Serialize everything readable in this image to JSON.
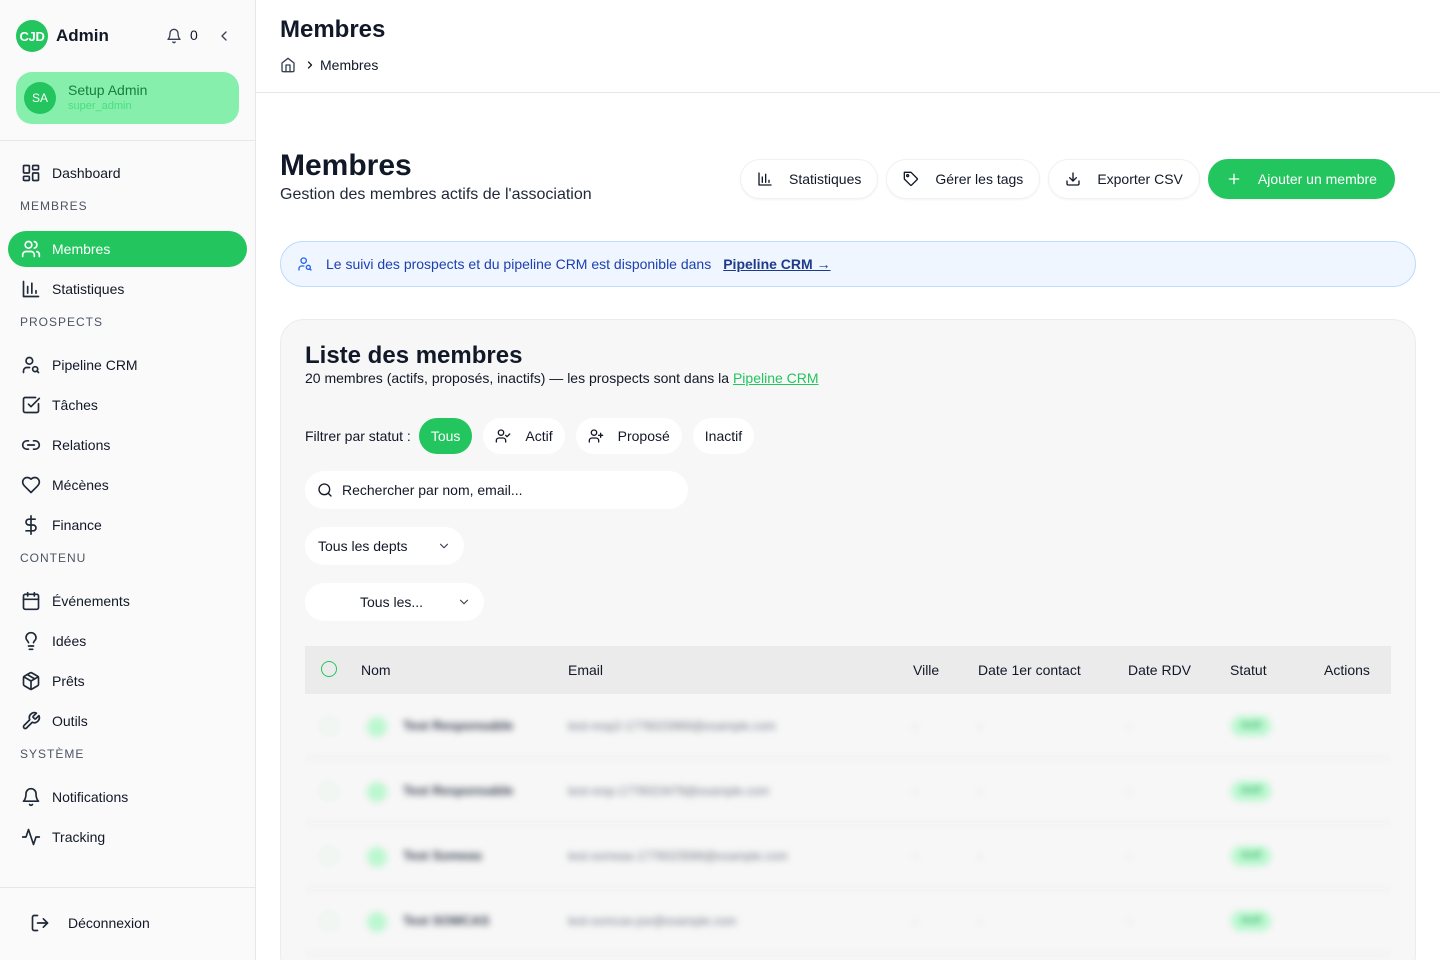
{
  "sidebar": {
    "logo_text": "CJD",
    "app_title": "Admin",
    "notif_count": "0",
    "user": {
      "initials": "SA",
      "name": "Setup Admin",
      "role": "super_admin"
    },
    "nav": [
      {
        "type": "item",
        "label": "Dashboard",
        "icon": "dashboard-icon",
        "active": false
      },
      {
        "type": "section",
        "label": "MEMBRES"
      },
      {
        "type": "item",
        "label": "Membres",
        "icon": "users-icon",
        "active": true
      },
      {
        "type": "item",
        "label": "Statistiques",
        "icon": "bar-chart-icon",
        "active": false
      },
      {
        "type": "section",
        "label": "PROSPECTS"
      },
      {
        "type": "item",
        "label": "Pipeline CRM",
        "icon": "user-search-icon",
        "active": false
      },
      {
        "type": "item",
        "label": "Tâches",
        "icon": "checkbox-icon",
        "active": false
      },
      {
        "type": "item",
        "label": "Relations",
        "icon": "link-icon",
        "active": false
      },
      {
        "type": "item",
        "label": "Mécènes",
        "icon": "heart-icon",
        "active": false
      },
      {
        "type": "item",
        "label": "Finance",
        "icon": "dollar-icon",
        "active": false
      },
      {
        "type": "section",
        "label": "CONTENU"
      },
      {
        "type": "item",
        "label": "Événements",
        "icon": "calendar-icon",
        "active": false
      },
      {
        "type": "item",
        "label": "Idées",
        "icon": "lightbulb-icon",
        "active": false
      },
      {
        "type": "item",
        "label": "Prêts",
        "icon": "package-icon",
        "active": false
      },
      {
        "type": "item",
        "label": "Outils",
        "icon": "wrench-icon",
        "active": false
      },
      {
        "type": "section",
        "label": "SYSTÈME"
      },
      {
        "type": "item",
        "label": "Notifications",
        "icon": "bell-icon",
        "active": false
      },
      {
        "type": "item",
        "label": "Tracking",
        "icon": "activity-icon",
        "active": false
      }
    ],
    "logout_label": "Déconnexion"
  },
  "header": {
    "title": "Membres",
    "breadcrumb": "Membres"
  },
  "page": {
    "title": "Membres",
    "subtitle": "Gestion des membres actifs de l'association",
    "buttons": {
      "stats": "Statistiques",
      "tags": "Gérer les tags",
      "export": "Exporter CSV",
      "add": "Ajouter un membre"
    },
    "banner": {
      "text": "Le suivi des prospects et du pipeline CRM est disponible dans",
      "link": "Pipeline CRM →"
    }
  },
  "list": {
    "title": "Liste des membres",
    "subtitle_prefix": "20 membres (actifs, proposés, inactifs) — les prospects sont dans la",
    "subtitle_link": "Pipeline CRM",
    "filter_label": "Filtrer par statut :",
    "filters": {
      "all": "Tous",
      "active": "Actif",
      "proposed": "Proposé",
      "inactive": "Inactif"
    },
    "search_placeholder": "Rechercher par nom, email...",
    "dept_select": "Tous les depts",
    "other_select": "Tous les...",
    "columns": {
      "name": "Nom",
      "email": "Email",
      "city": "Ville",
      "first_contact": "Date 1er contact",
      "rdv": "Date RDV",
      "status": "Statut",
      "actions": "Actions"
    },
    "rows": [
      {
        "name": "Test Responsable",
        "email": "test-resp2-1776023969@example.com",
        "city": "-",
        "first_contact": "-",
        "rdv": "-",
        "status": "Actif"
      },
      {
        "name": "Test Responsable",
        "email": "test-resp-1776023479@example.com",
        "city": "-",
        "first_contact": "-",
        "rdv": "-",
        "status": "Actif"
      },
      {
        "name": "Test Someas",
        "email": "test-someas-1776023589@example.com",
        "city": "-",
        "first_contact": "-",
        "rdv": "-",
        "status": "Actif"
      },
      {
        "name": "Test SOMCAS",
        "email": "test-somcas-joe@example.com",
        "city": "-",
        "first_contact": "-",
        "rdv": "-",
        "status": "Actif"
      }
    ]
  },
  "colors": {
    "accent": "#22c55e",
    "banner_bg": "#eff6ff",
    "banner_text": "#1e40af"
  }
}
